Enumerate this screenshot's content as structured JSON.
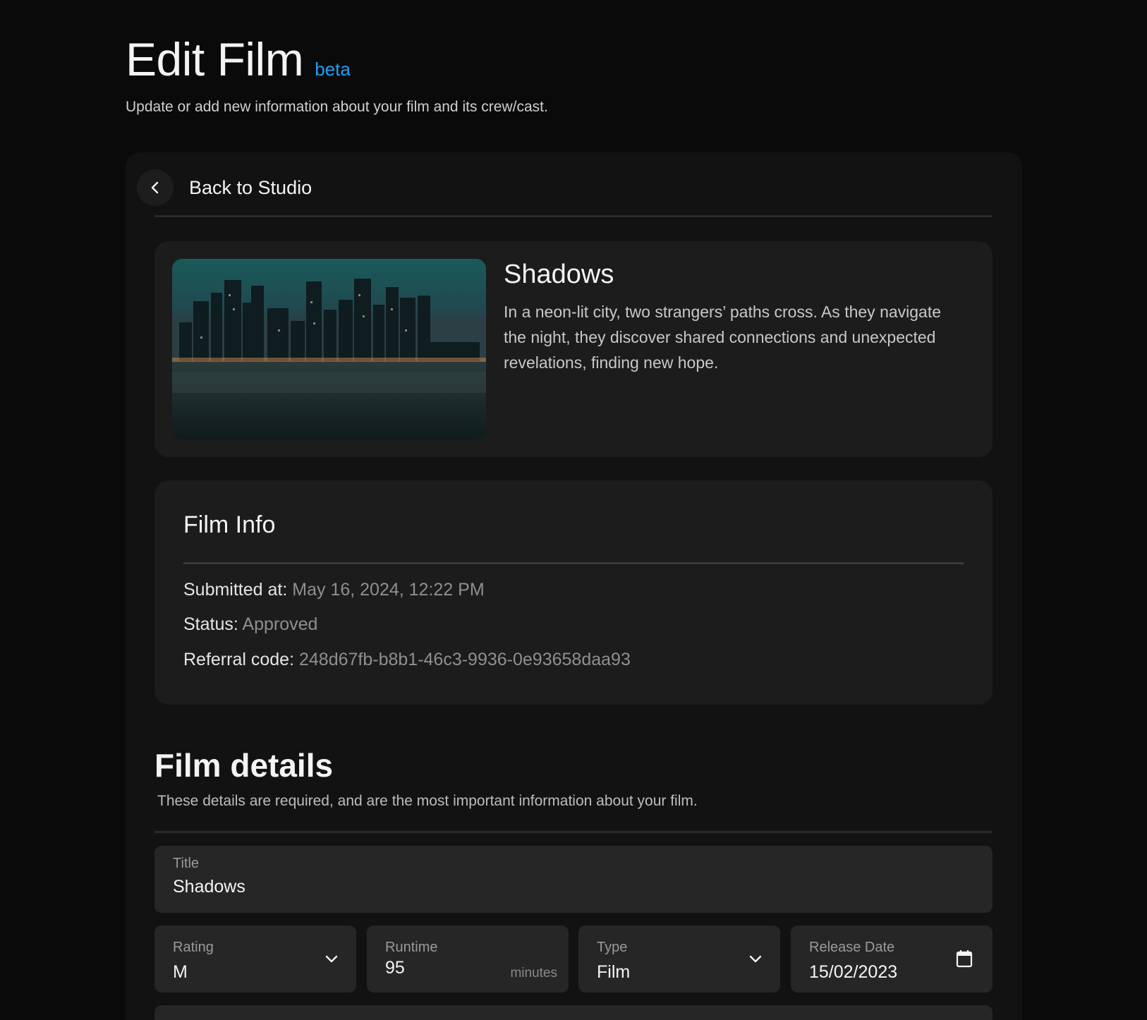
{
  "header": {
    "title": "Edit Film",
    "badge": "beta",
    "subtitle": "Update or add new information about your film and its crew/cast."
  },
  "nav": {
    "back_label": "Back to Studio",
    "back_icon": "chevron-left-icon"
  },
  "film": {
    "name": "Shadows",
    "description": "In a neon-lit city, two strangers’ paths cross. As they navigate the night, they discover shared connections and unexpected revelations, finding new hope."
  },
  "info": {
    "title": "Film Info",
    "submitted_label": "Submitted at:",
    "submitted_value": "May 16, 2024, 12:22 PM",
    "status_label": "Status:",
    "status_value": "Approved",
    "referral_label": "Referral code:",
    "referral_value": "248d67fb-b8b1-46c3-9936-0e93658daa93"
  },
  "details": {
    "title": "Film details",
    "subtitle": "These details are required, and are the most important information about your film.",
    "title_field": {
      "label": "Title",
      "value": "Shadows"
    },
    "rating": {
      "label": "Rating",
      "value": "M"
    },
    "runtime": {
      "label": "Runtime",
      "value": "95",
      "suffix": "minutes"
    },
    "type": {
      "label": "Type",
      "value": "Film"
    },
    "release": {
      "label": "Release Date",
      "value": "15/02/2023"
    }
  },
  "colors": {
    "background": "#0a0a0a",
    "panel": "#121212",
    "card": "#1c1c1c",
    "field": "#262626",
    "accent": "#1da1f2"
  }
}
